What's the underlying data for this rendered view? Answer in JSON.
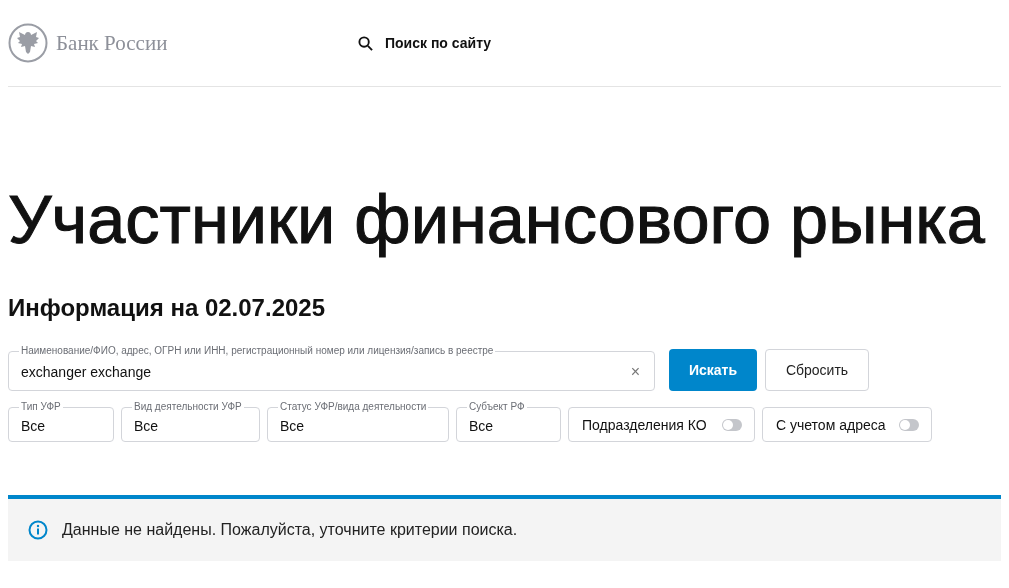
{
  "header": {
    "logo_text": "Банк России",
    "search_link": "Поиск по сайту"
  },
  "title": "Участники финансового рынка",
  "subtitle": "Информация на 02.07.2025",
  "search": {
    "label": "Наименование/ФИО, адрес, ОГРН или ИНН, регистрационный номер или лицензия/запись в реестре",
    "value": "exchanger exchange",
    "clear": "×"
  },
  "buttons": [
    {
      "label": "Искать",
      "kind": "primary"
    },
    {
      "label": "Сбросить",
      "kind": "secondary"
    }
  ],
  "filters": [
    {
      "kind": "select",
      "label": "Тип УФР",
      "value": "Все"
    },
    {
      "kind": "select",
      "label": "Вид деятельности УФР",
      "value": "Все"
    },
    {
      "kind": "select",
      "label": "Статус УФР/вида деятельности",
      "value": "Все"
    },
    {
      "kind": "select",
      "label": "Субъект РФ",
      "value": "Все"
    },
    {
      "kind": "toggle",
      "label": "Подразделения КО",
      "on": false
    },
    {
      "kind": "toggle",
      "label": "С учетом адреса",
      "on": false
    }
  ],
  "notice": "Данные не найдены. Пожалуйста, уточните критерии поиска."
}
